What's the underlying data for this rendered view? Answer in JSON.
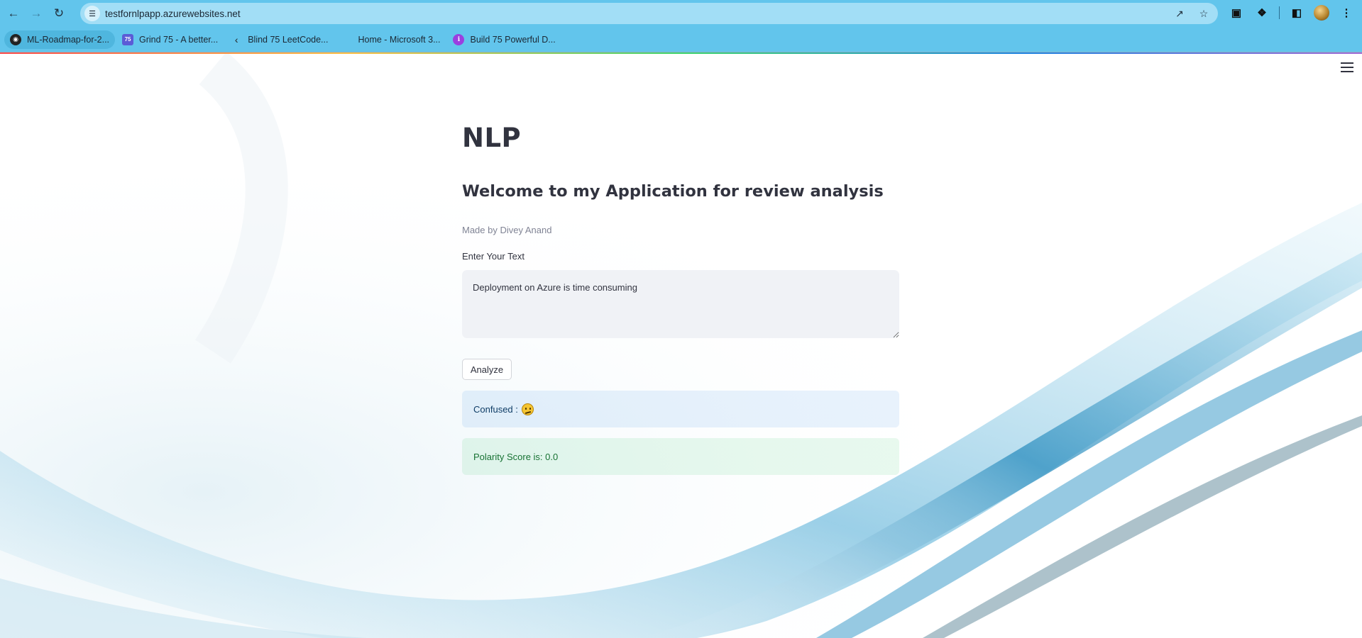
{
  "browser": {
    "url": "testfornlpapp.azurewebsites.net",
    "nav_icons": {
      "back": "arrow-left-icon",
      "forward": "arrow-right-icon",
      "reload": "reload-icon"
    },
    "bookmarks": [
      {
        "label": "ML-Roadmap-for-2...",
        "icon": "github-icon"
      },
      {
        "label": "Grind 75 - A better...",
        "icon": "grind75-icon"
      },
      {
        "label": "Blind 75 LeetCode...",
        "icon": "leetcode-icon"
      },
      {
        "label": "Home - Microsoft 3...",
        "icon": "microsoft-icon"
      },
      {
        "label": "Build 75 Powerful D...",
        "icon": "build-icon"
      }
    ],
    "accent_color": "#62c5ec"
  },
  "app": {
    "title": "NLP",
    "subtitle": "Welcome to my Application for review analysis",
    "caption": "Made by Divey Anand",
    "input_label": "Enter Your Text",
    "input_value": "Deployment on Azure is time consuming",
    "analyze_label": "Analyze",
    "result_info": "Confused :",
    "result_emoji": "confused-face-icon",
    "result_success": "Polarity Score is: 0.0",
    "colors": {
      "info_bg": "#e7f0fb",
      "success_bg": "#e5f6ea",
      "text": "#31333f"
    }
  }
}
